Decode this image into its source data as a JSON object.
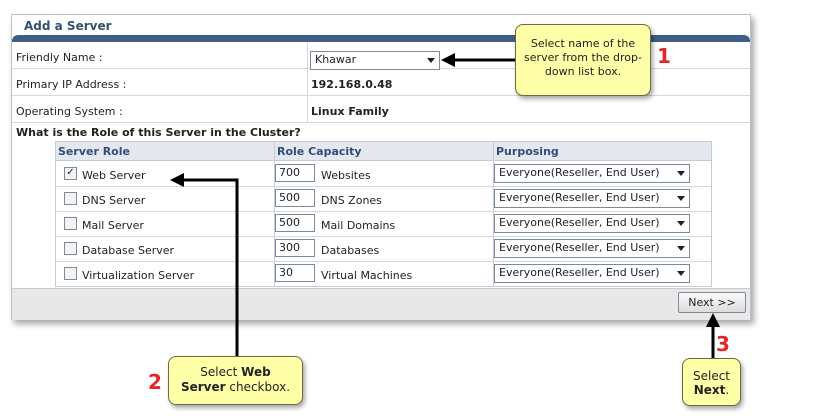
{
  "panel": {
    "title": "Add a Server"
  },
  "fields": {
    "friendly_name_label": "Friendly Name :",
    "friendly_name_value": "Khawar",
    "ip_label": "Primary IP Address :",
    "ip_value": "192.168.0.48",
    "os_label": "Operating System :",
    "os_value": "Linux Family"
  },
  "roles": {
    "heading": "What is the Role of this Server in the Cluster?",
    "columns": [
      "Server Role",
      "Role Capacity",
      "Purposing"
    ],
    "rows": [
      {
        "name": "Web Server",
        "checked": true,
        "capacity": "700",
        "unit": "Websites",
        "purposing": "Everyone(Reseller, End User)"
      },
      {
        "name": "DNS Server",
        "checked": false,
        "capacity": "500",
        "unit": "DNS Zones",
        "purposing": "Everyone(Reseller, End User)"
      },
      {
        "name": "Mail Server",
        "checked": false,
        "capacity": "500",
        "unit": "Mail Domains",
        "purposing": "Everyone(Reseller, End User)"
      },
      {
        "name": "Database Server",
        "checked": false,
        "capacity": "300",
        "unit": "Databases",
        "purposing": "Everyone(Reseller, End User)"
      },
      {
        "name": "Virtualization Server",
        "checked": false,
        "capacity": "30",
        "unit": "Virtual Machines",
        "purposing": "Everyone(Reseller, End User)"
      }
    ]
  },
  "next_label": "Next >>",
  "callouts": {
    "c1": {
      "number": "1",
      "text": "Select name of the server from the drop-down list box."
    },
    "c2": {
      "number": "2",
      "text_pre": "Select ",
      "text_bold1": "Web",
      "text_bold2": "Server",
      "text_post": " checkbox."
    },
    "c3": {
      "number": "3",
      "text_pre": "Select",
      "text_bold": "Next",
      "text_post": "."
    }
  },
  "colors": {
    "accent": "#3e5e85",
    "callout_bg": "#ffffa8",
    "step_number": "#e32626"
  }
}
